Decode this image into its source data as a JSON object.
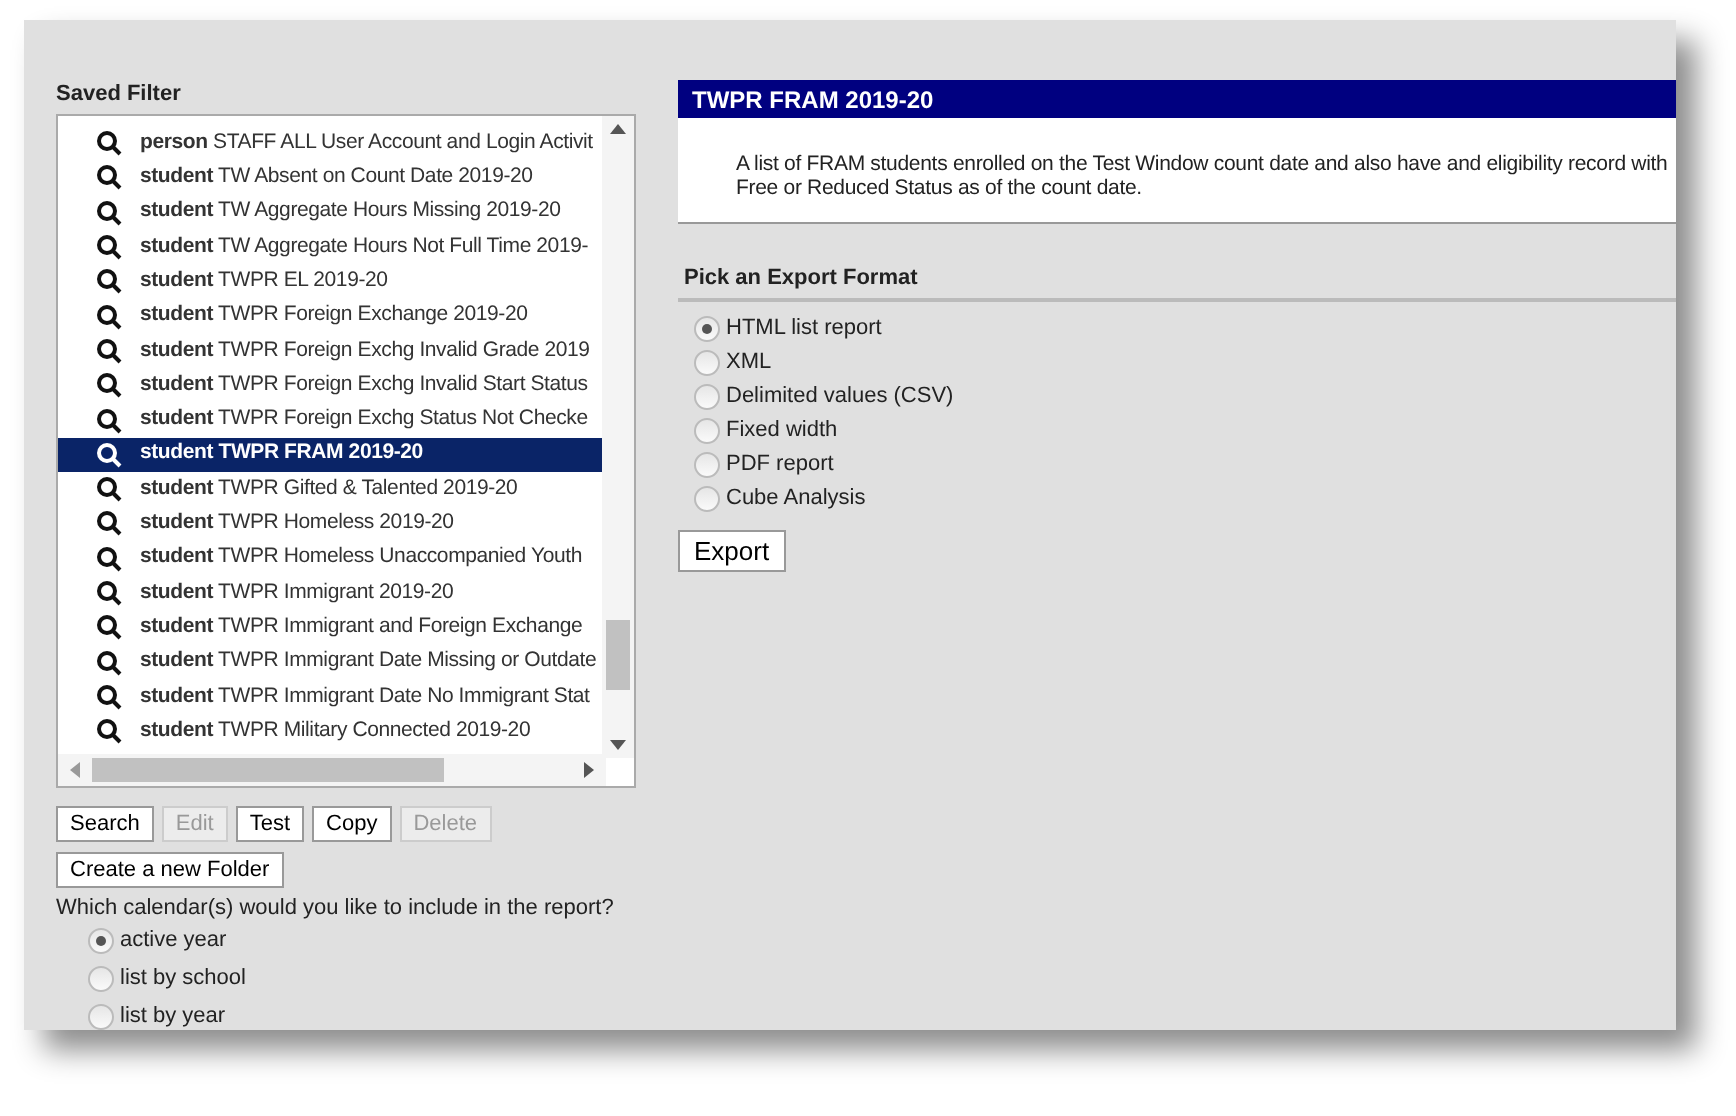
{
  "saved_filter": {
    "label": "Saved Filter",
    "items": [
      {
        "type": "person",
        "name": "STAFF ALL User Account and Login Activit",
        "selected": false
      },
      {
        "type": "student",
        "name": "TW Absent on Count Date 2019-20",
        "selected": false
      },
      {
        "type": "student",
        "name": "TW Aggregate Hours Missing 2019-20",
        "selected": false
      },
      {
        "type": "student",
        "name": "TW Aggregate Hours Not Full Time 2019-",
        "selected": false
      },
      {
        "type": "student",
        "name": "TWPR EL 2019-20",
        "selected": false
      },
      {
        "type": "student",
        "name": "TWPR Foreign Exchange 2019-20",
        "selected": false
      },
      {
        "type": "student",
        "name": "TWPR Foreign Exchg Invalid Grade 2019",
        "selected": false
      },
      {
        "type": "student",
        "name": "TWPR Foreign Exchg Invalid Start Status",
        "selected": false
      },
      {
        "type": "student",
        "name": "TWPR Foreign Exchg Status Not Checke",
        "selected": false
      },
      {
        "type": "student",
        "name": "TWPR FRAM 2019-20",
        "selected": true
      },
      {
        "type": "student",
        "name": "TWPR Gifted & Talented 2019-20",
        "selected": false
      },
      {
        "type": "student",
        "name": "TWPR Homeless 2019-20",
        "selected": false
      },
      {
        "type": "student",
        "name": "TWPR Homeless Unaccompanied Youth",
        "selected": false
      },
      {
        "type": "student",
        "name": "TWPR Immigrant 2019-20",
        "selected": false
      },
      {
        "type": "student",
        "name": "TWPR Immigrant and Foreign Exchange",
        "selected": false
      },
      {
        "type": "student",
        "name": "TWPR Immigrant Date Missing or Outdate",
        "selected": false
      },
      {
        "type": "student",
        "name": "TWPR Immigrant Date No Immigrant Stat",
        "selected": false
      },
      {
        "type": "student",
        "name": "TWPR Military Connected 2019-20",
        "selected": false
      }
    ]
  },
  "buttons": [
    {
      "label": "Search",
      "disabled": false
    },
    {
      "label": "Edit",
      "disabled": true
    },
    {
      "label": "Test",
      "disabled": false
    },
    {
      "label": "Copy",
      "disabled": false
    },
    {
      "label": "Delete",
      "disabled": true
    }
  ],
  "folder_button": "Create a new Folder",
  "calendar": {
    "question": "Which calendar(s) would you like to include in the report?",
    "options": [
      {
        "label": "active year",
        "selected": true
      },
      {
        "label": "list by school",
        "selected": false
      },
      {
        "label": "list by year",
        "selected": false
      }
    ]
  },
  "report": {
    "title": "TWPR FRAM 2019-20",
    "description_lines": [
      "A list of FRAM students enrolled on the Test Window count date and also have and eligibility record with",
      "Free or Reduced Status as of the count date."
    ]
  },
  "export": {
    "heading": "Pick an Export Format",
    "options": [
      {
        "label": "HTML list report",
        "selected": true
      },
      {
        "label": "XML",
        "selected": false
      },
      {
        "label": "Delimited values (CSV)",
        "selected": false
      },
      {
        "label": "Fixed width",
        "selected": false
      },
      {
        "label": "PDF report",
        "selected": false
      },
      {
        "label": "Cube Analysis",
        "selected": false
      }
    ],
    "button": "Export"
  }
}
